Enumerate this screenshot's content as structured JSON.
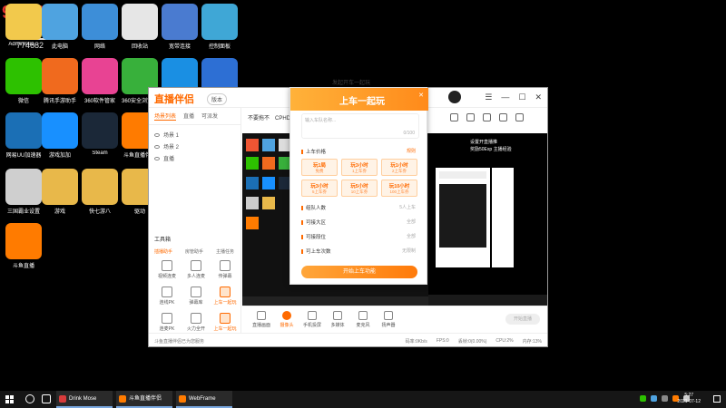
{
  "watermark": {
    "room_id": "9630591",
    "logo_text": "斗鱼",
    "sub_text": "774682"
  },
  "desktop_icons": [
    {
      "label": "Administra...",
      "color": "#f2c94c"
    },
    {
      "label": "此电脑",
      "color": "#4fa3e0"
    },
    {
      "label": "网络",
      "color": "#3d8ed8"
    },
    {
      "label": "回收站",
      "color": "#e6e6e6"
    },
    {
      "label": "宽带连接",
      "color": "#4a7bd0"
    },
    {
      "label": "控制面板",
      "color": "#3fa7d6"
    },
    {
      "label": "微信",
      "color": "#2dc100"
    },
    {
      "label": "腾讯手游助手",
      "color": "#f06a1e"
    },
    {
      "label": "360软件管家",
      "color": "#e84393"
    },
    {
      "label": "360安全浏览器",
      "color": "#38b03b"
    },
    {
      "label": "Microsoft Edge",
      "color": "#1a8fe3"
    },
    {
      "label": "Internet Explorer",
      "color": "#2d6fd4"
    },
    {
      "label": "网易UU加速器",
      "color": "#1b6fb5"
    },
    {
      "label": "游戏加加",
      "color": "#1890ff"
    },
    {
      "label": "Steam",
      "color": "#1b2838"
    },
    {
      "label": "斗鱼直播伴侣",
      "color": "#ff7b00"
    },
    {
      "label": "三国霸业设置",
      "color": "#cfcfcf"
    },
    {
      "label": "游戏",
      "color": "#e8b84a"
    },
    {
      "label": "快七游八",
      "color": "#e8b84a"
    },
    {
      "label": "驱动",
      "color": "#e8b84a"
    },
    {
      "label": "斗鱼直播",
      "color": "#ff7b00"
    }
  ],
  "app": {
    "logo": "直播伴侣",
    "logo_badge": "版本",
    "top_tabs": [
      "场景列表",
      "直播",
      "可派发"
    ],
    "scenes": [
      "场景 1",
      "场景 2",
      "直播"
    ],
    "notice": "不要拖不",
    "notice_sub": "CPHD  弹幕信息",
    "tools_header": "工具箱",
    "tool_tabs": [
      "插播助手",
      "房管助手",
      "主播任务"
    ],
    "tools": [
      "视频连麦",
      "多人连麦",
      "传弹幕",
      "连线PK",
      "弹幕库",
      "上车一起玩",
      "连麦PK",
      "火力全开",
      "上车一起玩"
    ],
    "right_preview_text_1": "设置开直播推",
    "right_preview_text_2": "奖励50Exp 主播经验",
    "bottom_items": [
      "直播画面",
      "摄像头",
      "手机投屏",
      "多媒体",
      "麦克风",
      "扬声器"
    ],
    "bottom_active": 1,
    "start_live": "开始直播",
    "status_left": "斗鱼直播伴侣已为您服务",
    "status_right": [
      "码率:0Kb/s",
      "FPS:0",
      "丢帧:0(0.00%)",
      "CPU:2%",
      "内存:13%"
    ]
  },
  "popup": {
    "window_title": "发起开车一起玩",
    "header": "上车一起玩",
    "close": "✕",
    "textarea_placeholder": "输入车队名称...",
    "textarea_count": "0/100",
    "section_price": "上车价格",
    "section_price_note": "规则",
    "price_options": [
      {
        "title": "玩1局",
        "sub": "免费"
      },
      {
        "title": "玩3小时",
        "sub": "1上车券"
      },
      {
        "title": "玩1小时",
        "sub": "2上车券"
      },
      {
        "title": "玩3小时",
        "sub": "5上车券"
      },
      {
        "title": "玩5小时",
        "sub": "10上车券"
      },
      {
        "title": "玩10小时",
        "sub": "100上车券"
      }
    ],
    "section_team": "组队人数",
    "section_team_val": "5人上车",
    "section_region": "可接大区",
    "section_region_val": "全部",
    "section_rank": "可接段位",
    "section_rank_val": "全部",
    "section_freq": "可上车次数",
    "section_freq_val": "无限制",
    "button": "开始上车功能"
  },
  "taskbar": {
    "tasks": [
      {
        "label": "Drink Mose (Orig...",
        "color": "#d83b3b"
      },
      {
        "label": "斗鱼直播伴侣",
        "color": "#ff7b00"
      },
      {
        "label": "WebFrame",
        "color": "#ff7b00"
      }
    ],
    "time": "5:27",
    "date": "2021-07-12"
  }
}
